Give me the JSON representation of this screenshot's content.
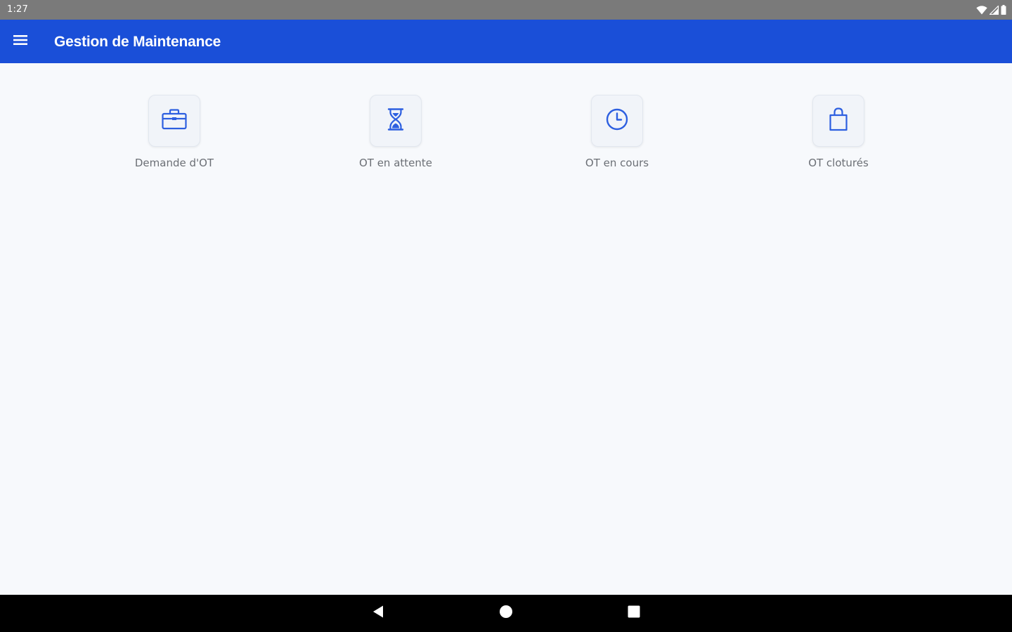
{
  "status_bar": {
    "time": "1:27",
    "icons": [
      "wifi-icon",
      "cellular-signal-icon",
      "battery-icon"
    ]
  },
  "app_bar": {
    "title": "Gestion de Maintenance",
    "menu_icon": "hamburger-menu-icon",
    "background_color": "#1a4fd8"
  },
  "tiles": [
    {
      "label": "Demande d'OT",
      "icon": "briefcase-icon"
    },
    {
      "label": "OT en attente",
      "icon": "hourglass-icon"
    },
    {
      "label": "OT en cours",
      "icon": "clock-icon"
    },
    {
      "label": "OT cloturés",
      "icon": "shopping-bag-icon"
    }
  ],
  "nav_bar": {
    "buttons": [
      "back-icon",
      "home-icon",
      "recents-icon"
    ]
  },
  "colors": {
    "accent": "#1a4fd8",
    "icon_blue": "#2d5fe0",
    "label_gray": "#6b6f75"
  }
}
